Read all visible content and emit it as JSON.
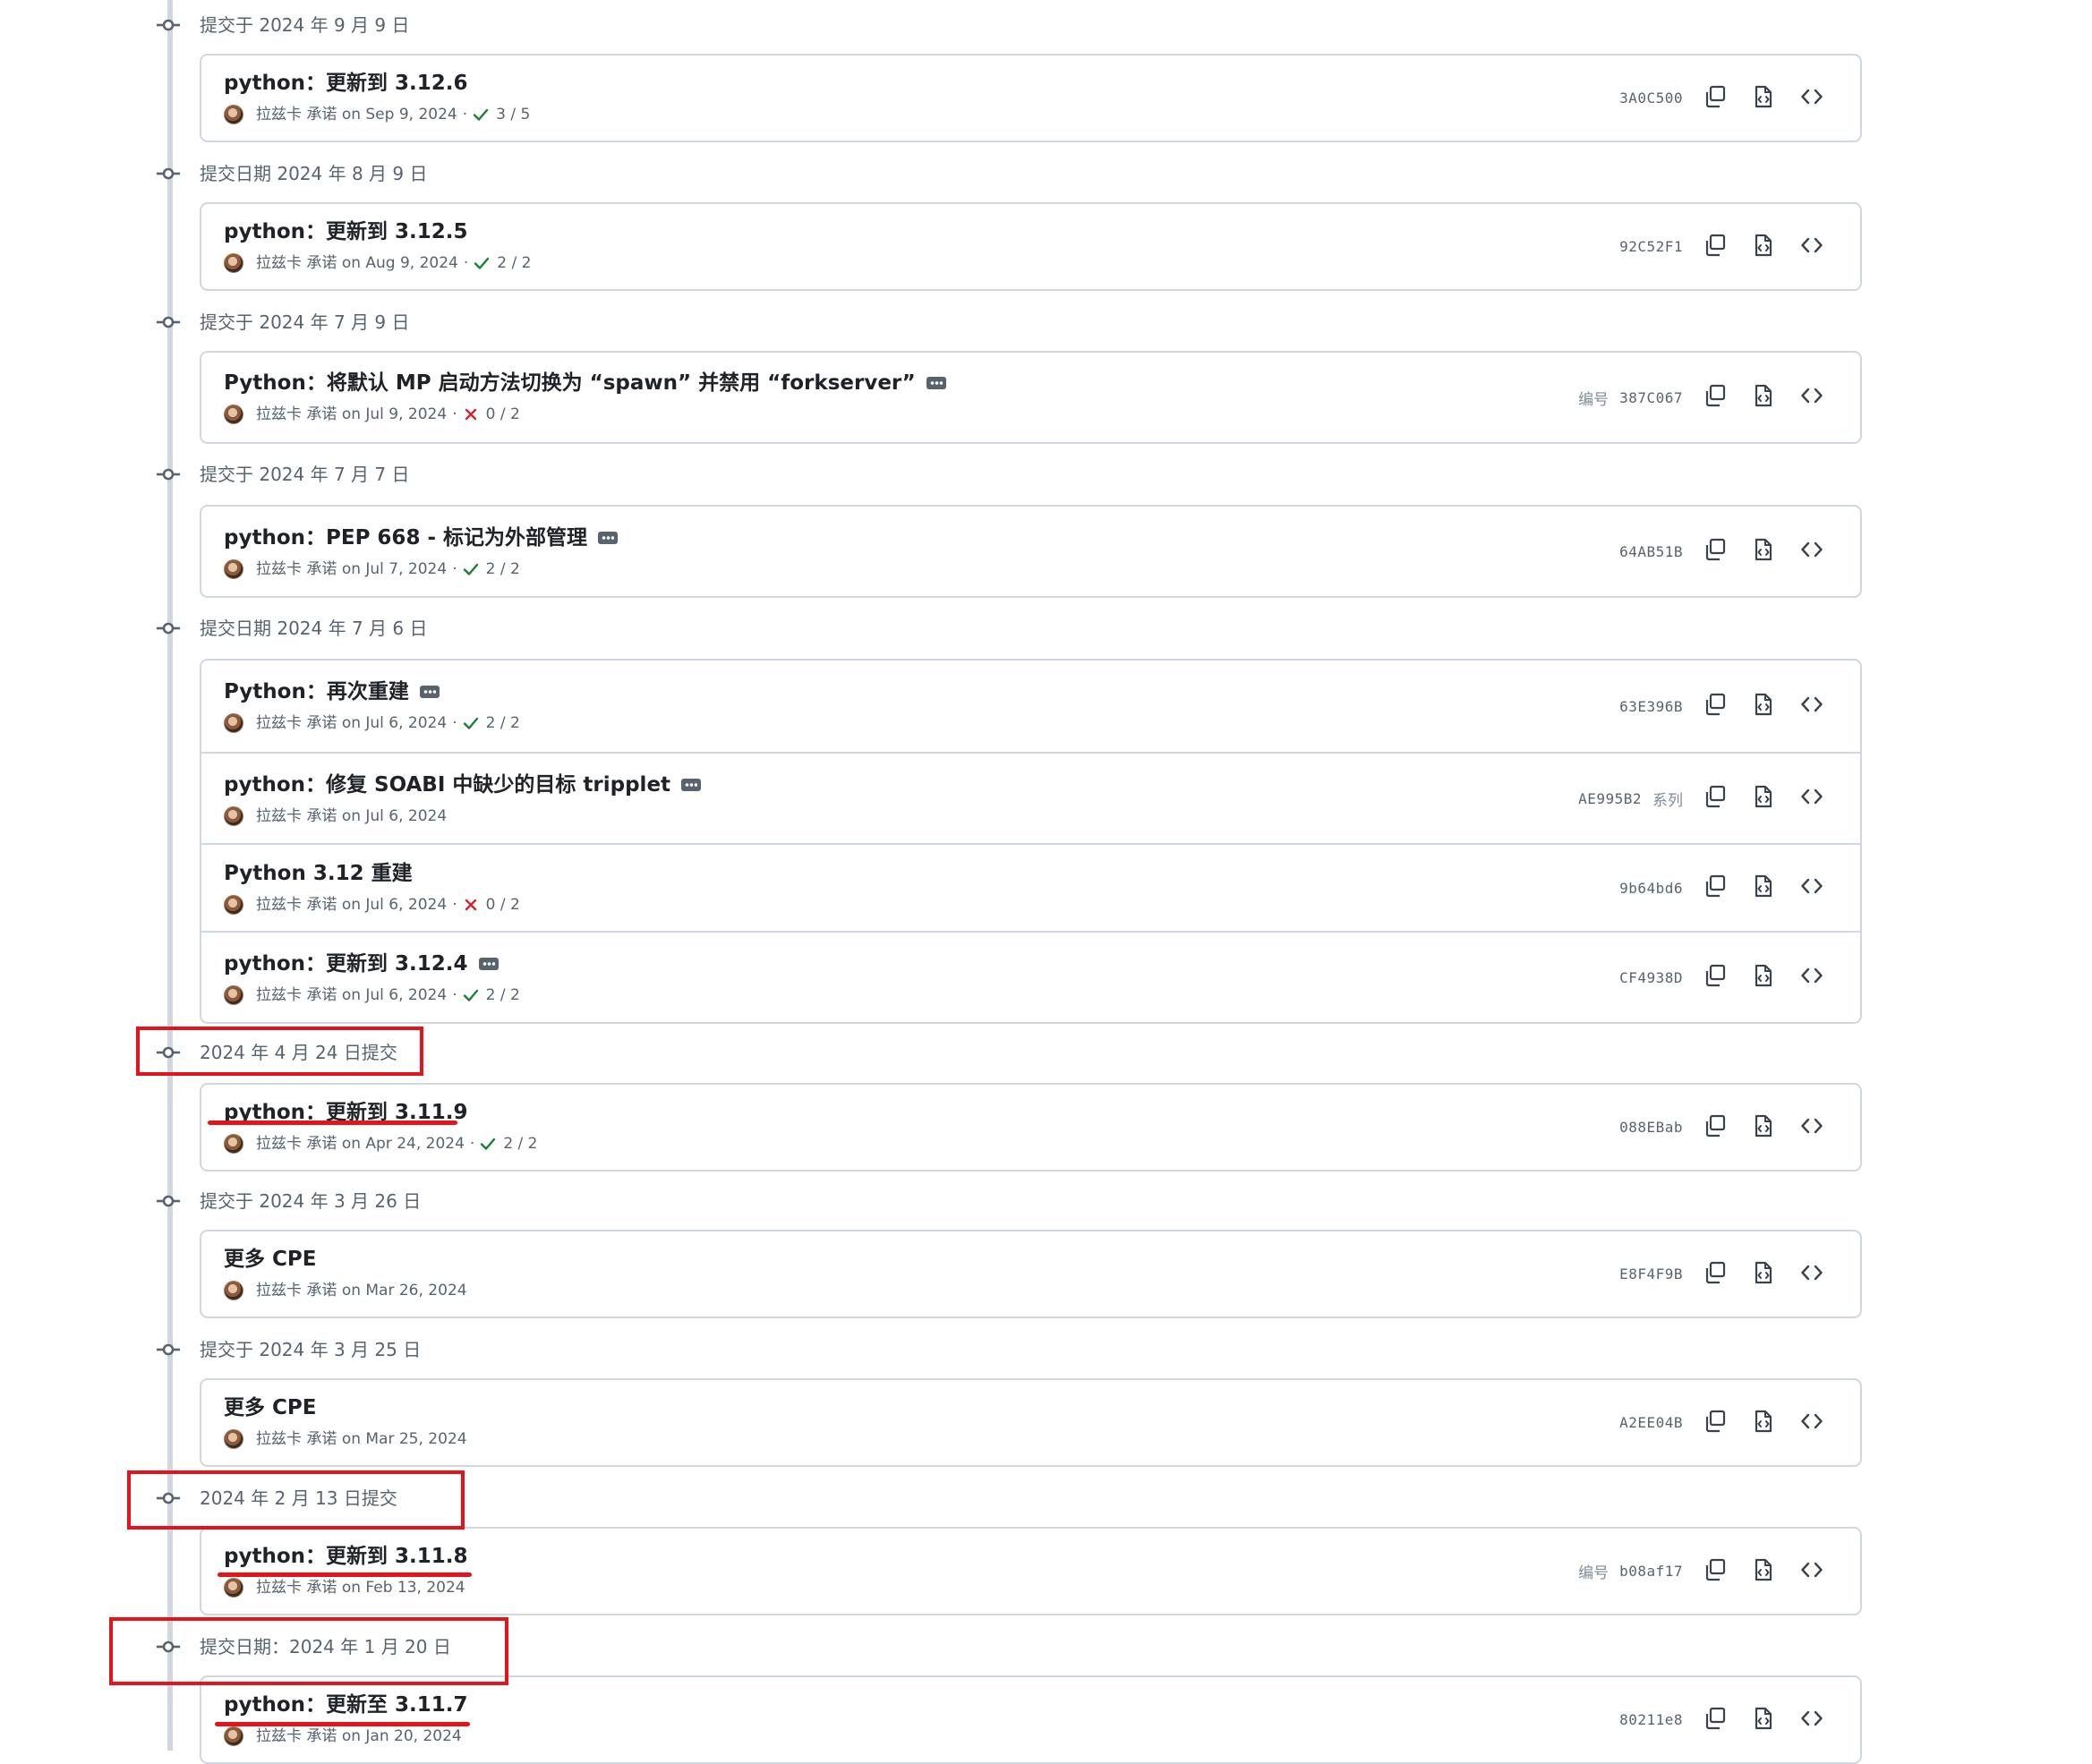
{
  "groups": [
    {
      "date": "提交于 2024 年 9 月 9 日",
      "commits": [
        {
          "title": "python：更新到 3.12.6",
          "author": "拉兹卡 承诺",
          "when": "on Sep 9, 2024",
          "status": "check",
          "checks": "3 / 5",
          "id_prefix": "",
          "sha": "3A0C500",
          "suffix": "",
          "has_ellipsis": false
        }
      ]
    },
    {
      "date": "提交日期 2024 年 8 月 9 日",
      "commits": [
        {
          "title": "python：更新到 3.12.5",
          "author": "拉兹卡 承诺",
          "when": "on Aug 9, 2024",
          "status": "check",
          "checks": "2 / 2",
          "id_prefix": "",
          "sha": "92C52F1",
          "suffix": "",
          "has_ellipsis": false
        }
      ]
    },
    {
      "date": "提交于 2024 年 7 月 9 日",
      "commits": [
        {
          "title": "Python：将默认 MP 启动方法切换为 “spawn” 并禁用 “forkserver”",
          "author": "拉兹卡 承诺",
          "when": "on Jul 9, 2024",
          "status": "cross",
          "checks": "0 / 2",
          "id_prefix": "编号",
          "sha": "387C067",
          "suffix": "",
          "has_ellipsis": true
        }
      ]
    },
    {
      "date": "提交于 2024 年 7 月 7 日",
      "commits": [
        {
          "title": "python：PEP 668 - 标记为外部管理",
          "author": "拉兹卡 承诺",
          "when": "on Jul 7, 2024",
          "status": "check",
          "checks": "2 / 2",
          "id_prefix": "",
          "sha": "64AB51B",
          "suffix": "",
          "has_ellipsis": true
        }
      ]
    },
    {
      "date": "提交日期 2024 年 7 月 6 日",
      "commits": [
        {
          "title": "Python：再次重建",
          "author": "拉兹卡 承诺",
          "when": "on Jul 6, 2024",
          "status": "check",
          "checks": "2 / 2",
          "id_prefix": "",
          "sha": "63E396B",
          "suffix": "",
          "has_ellipsis": true
        },
        {
          "title": "python：修复 SOABI 中缺少的目标 tripplet",
          "author": "拉兹卡 承诺",
          "when": "on Jul 6, 2024",
          "status": "none",
          "checks": "",
          "id_prefix": "",
          "sha": "AE995B2",
          "suffix": "系列",
          "has_ellipsis": true
        },
        {
          "title": "Python 3.12 重建",
          "author": "拉兹卡 承诺",
          "when": "on Jul 6, 2024",
          "status": "cross",
          "checks": "0 / 2",
          "id_prefix": "",
          "sha": "9b64bd6",
          "suffix": "",
          "has_ellipsis": false
        },
        {
          "title": "python：更新到 3.12.4",
          "author": "拉兹卡 承诺",
          "when": "on Jul 6, 2024",
          "status": "check",
          "checks": "2 / 2",
          "id_prefix": "",
          "sha": "CF4938D",
          "suffix": "",
          "has_ellipsis": true
        }
      ]
    },
    {
      "date": "2024 年 4 月 24 日提交",
      "commits": [
        {
          "title": "python：更新到 3.11.9",
          "author": "拉兹卡 承诺",
          "when": "on Apr 24, 2024",
          "status": "check",
          "checks": "2 / 2",
          "id_prefix": "",
          "sha": "088EBab",
          "suffix": "",
          "has_ellipsis": false
        }
      ]
    },
    {
      "date": "提交于 2024 年 3 月 26 日",
      "commits": [
        {
          "title": "更多 CPE",
          "author": "拉兹卡 承诺",
          "when": "on Mar 26, 2024",
          "status": "none",
          "checks": "",
          "id_prefix": "",
          "sha": "E8F4F9B",
          "suffix": "",
          "has_ellipsis": false
        }
      ]
    },
    {
      "date": "提交于 2024 年 3 月 25 日",
      "commits": [
        {
          "title": "更多 CPE",
          "author": "拉兹卡 承诺",
          "when": "on Mar 25, 2024",
          "status": "none",
          "checks": "",
          "id_prefix": "",
          "sha": "A2EE04B",
          "suffix": "",
          "has_ellipsis": false
        }
      ]
    },
    {
      "date": "2024 年 2 月 13 日提交",
      "commits": [
        {
          "title": "python：更新到 3.11.8",
          "author": "拉兹卡 承诺",
          "when": "on Feb 13, 2024",
          "status": "none",
          "checks": "",
          "id_prefix": "编号",
          "sha": "b08af17",
          "suffix": "",
          "has_ellipsis": false
        }
      ]
    },
    {
      "date": "提交日期：2024 年 1 月 20 日",
      "commits": [
        {
          "title": "python：更新至 3.11.7",
          "author": "拉兹卡 承诺",
          "when": "on Jan 20, 2024",
          "status": "none",
          "checks": "",
          "id_prefix": "",
          "sha": "80211e8",
          "suffix": "",
          "has_ellipsis": false
        }
      ]
    }
  ],
  "icons": {
    "commit": "git-commit-icon",
    "copy": "copy-icon",
    "browse": "file-code-icon",
    "code": "code-icon",
    "check": "check-icon",
    "cross": "x-icon",
    "more": "kebab-ellipsis-icon"
  },
  "colors": {
    "check": "#1a7f37",
    "cross": "#d1242f",
    "annotation": "#e5141b",
    "border": "#d0d7de",
    "muted": "#59636e"
  }
}
